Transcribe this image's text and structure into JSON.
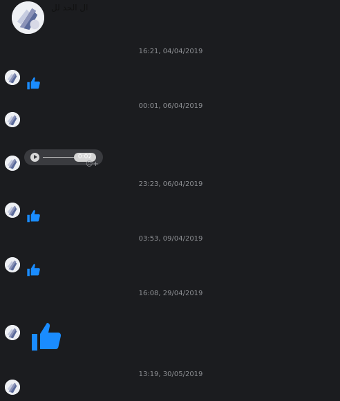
{
  "header": {
    "contact_name": "ال الحد لل"
  },
  "conversation": {
    "timestamps": [
      "16:21, 04/04/2019",
      "00:01, 06/04/2019",
      "23:23, 06/04/2019",
      "03:53, 09/04/2019",
      "16:08, 29/04/2019",
      "13:19, 30/05/2019"
    ],
    "audio_message": {
      "duration": "0:02",
      "react_glyph": "☺+"
    }
  },
  "colors": {
    "background": "#1b1c1f",
    "like_blue": "#1a8cff",
    "timestamp_text": "#8d8f93",
    "audio_bubble": "#3a3b3f"
  },
  "icons": {
    "like": "thumbs-up-icon",
    "play": "play-icon",
    "react": "add-reaction-icon"
  }
}
